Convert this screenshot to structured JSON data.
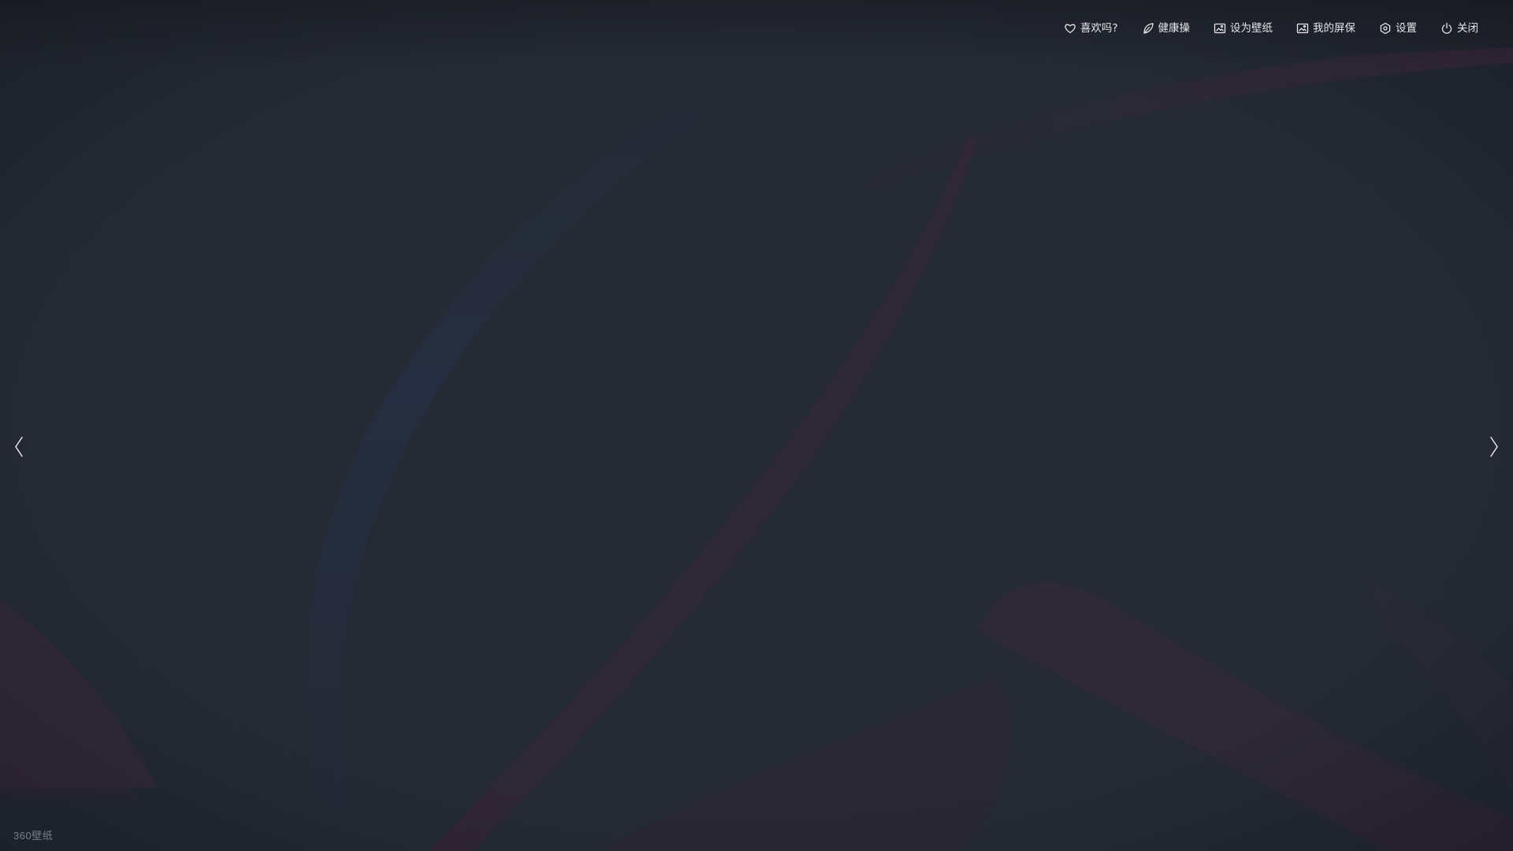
{
  "toolbar": {
    "like_label": "喜欢吗?",
    "exercise_label": "健康操",
    "set_wallpaper_label": "设为壁纸",
    "my_screensaver_label": "我的屏保",
    "settings_label": "设置",
    "close_label": "关闭"
  },
  "icons": {
    "like": "heart-icon",
    "exercise": "leaf-icon",
    "set_wallpaper": "image-icon",
    "my_screensaver": "image-icon",
    "settings": "settings-icon",
    "close": "power-icon",
    "prev": "chevron-left-icon",
    "next": "chevron-right-icon"
  },
  "brand": {
    "text": "360壁纸"
  },
  "colors": {
    "background": "#242832",
    "ribbon_accent": "#3a2a3c",
    "text": "#e6e6ea"
  }
}
